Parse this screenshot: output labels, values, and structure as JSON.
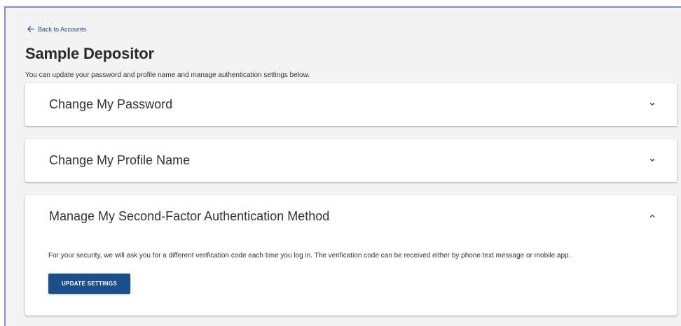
{
  "nav": {
    "back_label": "Back to Accounts"
  },
  "page": {
    "title": "Sample Depositor",
    "intro": "You can update your password and profile name and manage authentication settings below."
  },
  "panels": [
    {
      "title": "Change My Password",
      "expanded": false
    },
    {
      "title": "Change My Profile Name",
      "expanded": false
    },
    {
      "title": "Manage My Second-Factor Authentication Method",
      "expanded": true,
      "body": "For your security, we will ask you for a different verification code each time you log in. The verification code can be received either by phone text message or mobile app.",
      "button_label": "UPDATE SETTINGS"
    }
  ],
  "colors": {
    "accent": "#1a4f8c",
    "page_background": "#f3f3f3",
    "frame_border": "#7a93c4"
  },
  "icons": {
    "back": "arrow-left-icon",
    "collapsed": "chevron-down-icon",
    "expanded": "chevron-up-icon"
  }
}
